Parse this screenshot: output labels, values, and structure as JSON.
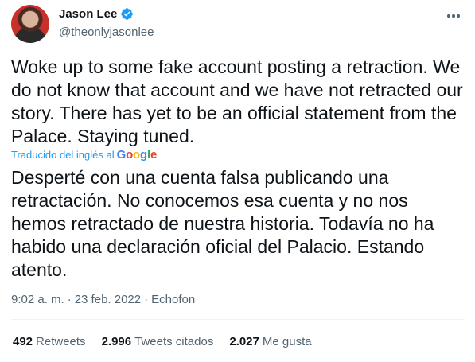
{
  "author": {
    "name": "Jason Lee",
    "handle": "@theonlyjasonlee",
    "verified_color": "#1d9bf0"
  },
  "tweet": {
    "text": "Woke up to some fake account posting a retraction. We do not know that account and we have not retracted our story. There has yet to be an official statement from the Palace. Staying tuned.",
    "translated_label": "Traducido del inglés al",
    "translation_provider": "Google",
    "translation": "Desperté con una cuenta falsa publicando una retractación. No conocemos esa cuenta y no nos hemos retractado de nuestra historia. Todavía no ha habido una declaración oficial del Palacio. Estando atento."
  },
  "meta": {
    "time": "9:02 a. m.",
    "separator": "·",
    "date": "23 feb. 2022",
    "source": "Echofon"
  },
  "stats": {
    "retweets_count": "492",
    "retweets_label": "Retweets",
    "quotes_count": "2.996",
    "quotes_label": "Tweets citados",
    "likes_count": "2.027",
    "likes_label": "Me gusta"
  },
  "icons": {
    "more": "more-options-icon",
    "verified": "verified-badge-icon"
  },
  "colors": {
    "link": "#1d9bf0",
    "secondary": "#536471",
    "text": "#0f1419"
  }
}
